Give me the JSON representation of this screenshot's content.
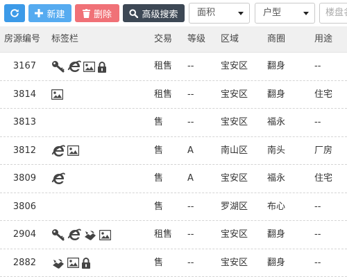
{
  "toolbar": {
    "add_label": "新建",
    "delete_label": "删除",
    "search_label": "高级搜索",
    "area_select": "面积",
    "type_select": "户型",
    "biz_placeholder": "楼盘名"
  },
  "columns": [
    "房源编号",
    "标签栏",
    "交易",
    "等级",
    "区域",
    "商圈",
    "用途"
  ],
  "rows": [
    {
      "id": "3167",
      "tags": [
        "key",
        "ie",
        "image",
        "lock"
      ],
      "deal": "租售",
      "grade": "--",
      "district": "宝安区",
      "biz": "翻身",
      "use": "--"
    },
    {
      "id": "3814",
      "tags": [
        "image"
      ],
      "deal": "租售",
      "grade": "--",
      "district": "宝安区",
      "biz": "翻身",
      "use": "住宅"
    },
    {
      "id": "3813",
      "tags": [],
      "deal": "售",
      "grade": "--",
      "district": "宝安区",
      "biz": "福永",
      "use": "--"
    },
    {
      "id": "3812",
      "tags": [
        "ie",
        "image"
      ],
      "deal": "售",
      "grade": "A",
      "district": "南山区",
      "biz": "南头",
      "use": "厂房"
    },
    {
      "id": "3809",
      "tags": [
        "ie"
      ],
      "deal": "售",
      "grade": "A",
      "district": "宝安区",
      "biz": "福永",
      "use": "住宅"
    },
    {
      "id": "3806",
      "tags": [],
      "deal": "售",
      "grade": "--",
      "district": "罗湖区",
      "biz": "布心",
      "use": "--"
    },
    {
      "id": "2904",
      "tags": [
        "key",
        "ie",
        "handshake",
        "image"
      ],
      "deal": "租售",
      "grade": "--",
      "district": "宝安区",
      "biz": "翻身",
      "use": "--"
    },
    {
      "id": "2882",
      "tags": [
        "handshake",
        "image",
        "lock"
      ],
      "deal": "售",
      "grade": "--",
      "district": "宝安区",
      "biz": "翻身",
      "use": "--"
    }
  ],
  "colors": {
    "refresh": "#3c9ae8",
    "add": "#56abf0",
    "delete": "#f07177",
    "search": "#3d4855",
    "header_bg": "#f0f0f0"
  }
}
